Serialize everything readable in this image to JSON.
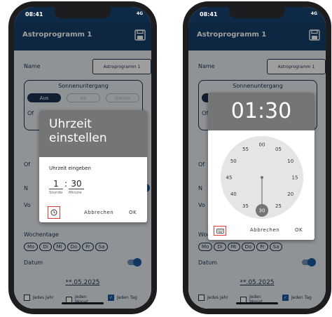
{
  "status_bar": {
    "time": "08:41",
    "network": "4G"
  },
  "app_bar": {
    "title": "Astroprogramm 1"
  },
  "form": {
    "name_label": "Name",
    "name_value": "Astroprogramm 1",
    "sonnenuntergang": {
      "title": "Sonnenuntergang",
      "mode_aus": "Aus",
      "mode_ab": "Ab",
      "mode_sonne": "Sonne",
      "row_label": "Of"
    },
    "side_labels": [
      "Of",
      "N",
      "Vo"
    ],
    "wochentage": {
      "label": "Wochentage",
      "days": [
        "Mo",
        "Di",
        "Mi",
        "Do",
        "Fr",
        "Sa"
      ]
    },
    "datum": {
      "label": "Datum",
      "value": "**.05.2025"
    },
    "checkboxes": [
      {
        "label": "Jedes Jahr",
        "checked": false
      },
      {
        "label": "Jeden Monat",
        "checked": false
      },
      {
        "label": "Jeden Tag",
        "checked": true
      }
    ]
  },
  "dialog_input": {
    "title": "Uhrzeit einstellen",
    "subtitle": "Uhrzeit eingeben",
    "hour": "1",
    "colon": ":",
    "minute": "30",
    "hour_hint": "Stunde",
    "minute_hint": "Minute",
    "cancel": "Abbrechen",
    "ok": "OK"
  },
  "dialog_clock": {
    "time_display": "01:30",
    "dial": [
      "00",
      "05",
      "10",
      "15",
      "20",
      "25",
      "30",
      "35",
      "40",
      "45",
      "50",
      "55"
    ],
    "selected_minute": 30,
    "cancel": "Abbrechen",
    "ok": "OK"
  },
  "colors": {
    "app_bar": "#16406d",
    "status_bar": "#0f2a47",
    "dialog_header": "#757575",
    "selection": "#757575",
    "highlight": "#e53935",
    "toggle_on": "#1a5aa0"
  }
}
